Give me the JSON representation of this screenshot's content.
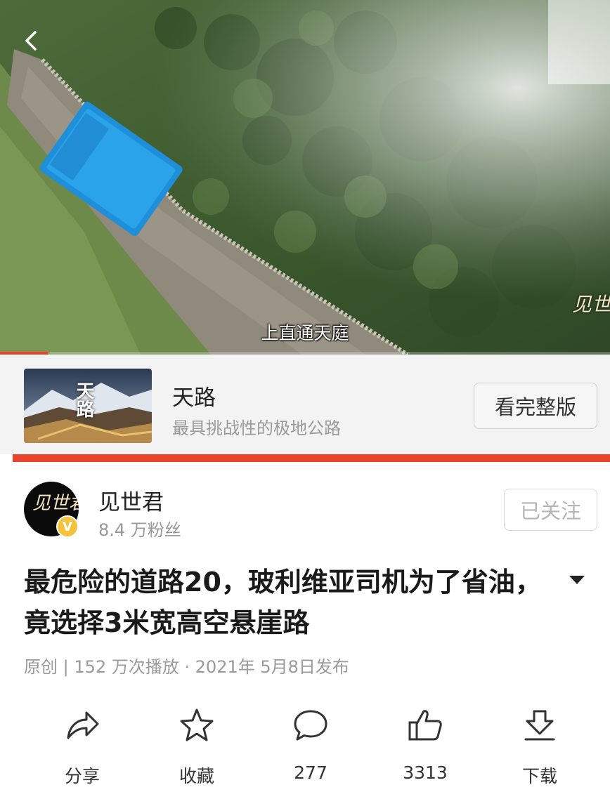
{
  "video": {
    "subtitle": "上直通天庭",
    "watermark": "见世君",
    "progress": 0.08,
    "accent_color": "#e8452c"
  },
  "series": {
    "thumb_text": "天路",
    "title": "天路",
    "description": "最具挑战性的极地公路",
    "full_button": "看完整版"
  },
  "author": {
    "avatar_text": "见世君",
    "name": "见世君",
    "fans": "8.4 万粉丝",
    "follow_label": "已关注",
    "verified_icon": "verified-v-icon"
  },
  "title": "最危险的道路20，玻利维亚司机为了省油，竟选择3米宽高空悬崖路",
  "meta": "原创 | 152 万次播放 · 2021年 5月8日发布",
  "actions": [
    {
      "icon": "share-icon",
      "label": "分享"
    },
    {
      "icon": "star-icon",
      "label": "收藏"
    },
    {
      "icon": "comment-icon",
      "label": "277"
    },
    {
      "icon": "thumbs-up-icon",
      "label": "3313"
    },
    {
      "icon": "download-icon",
      "label": "下载"
    }
  ]
}
